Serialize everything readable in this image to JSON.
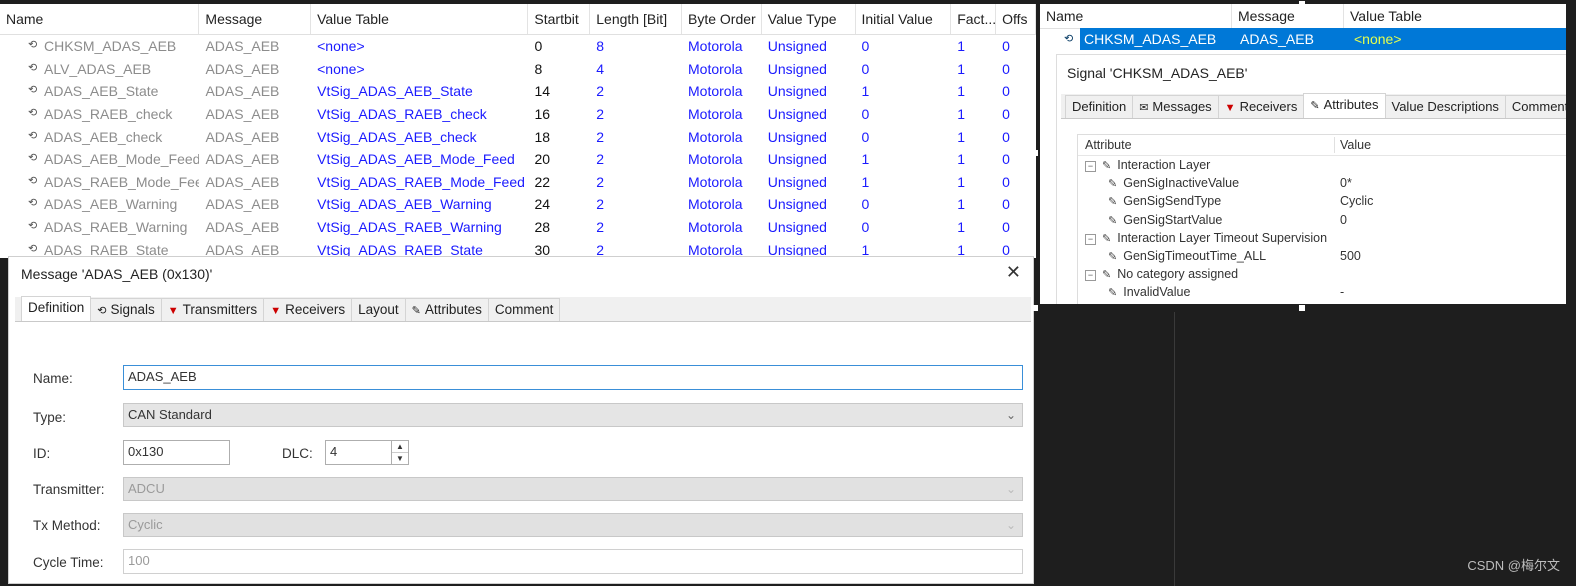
{
  "left_table": {
    "columns": [
      "Name",
      "Message",
      "Value Table",
      "Startbit",
      "Length [Bit]",
      "Byte Order",
      "Value Type",
      "Initial Value",
      "Fact...",
      "Offs"
    ],
    "rows": [
      {
        "name": "CHKSM_ADAS_AEB",
        "message": "ADAS_AEB",
        "value_table": "<none>",
        "startbit": "0",
        "length": "8",
        "byte_order": "Motorola",
        "value_type": "Unsigned",
        "initial": "0",
        "factor": "1",
        "offset": "0"
      },
      {
        "name": "ALV_ADAS_AEB",
        "message": "ADAS_AEB",
        "value_table": "<none>",
        "startbit": "8",
        "length": "4",
        "byte_order": "Motorola",
        "value_type": "Unsigned",
        "initial": "0",
        "factor": "1",
        "offset": "0"
      },
      {
        "name": "ADAS_AEB_State",
        "message": "ADAS_AEB",
        "value_table": "VtSig_ADAS_AEB_State",
        "startbit": "14",
        "length": "2",
        "byte_order": "Motorola",
        "value_type": "Unsigned",
        "initial": "1",
        "factor": "1",
        "offset": "0"
      },
      {
        "name": "ADAS_RAEB_check",
        "message": "ADAS_AEB",
        "value_table": "VtSig_ADAS_RAEB_check",
        "startbit": "16",
        "length": "2",
        "byte_order": "Motorola",
        "value_type": "Unsigned",
        "initial": "0",
        "factor": "1",
        "offset": "0"
      },
      {
        "name": "ADAS_AEB_check",
        "message": "ADAS_AEB",
        "value_table": "VtSig_ADAS_AEB_check",
        "startbit": "18",
        "length": "2",
        "byte_order": "Motorola",
        "value_type": "Unsigned",
        "initial": "0",
        "factor": "1",
        "offset": "0"
      },
      {
        "name": "ADAS_AEB_Mode_Feed",
        "message": "ADAS_AEB",
        "value_table": "VtSig_ADAS_AEB_Mode_Feed",
        "startbit": "20",
        "length": "2",
        "byte_order": "Motorola",
        "value_type": "Unsigned",
        "initial": "1",
        "factor": "1",
        "offset": "0"
      },
      {
        "name": "ADAS_RAEB_Mode_Feed",
        "message": "ADAS_AEB",
        "value_table": "VtSig_ADAS_RAEB_Mode_Feed",
        "startbit": "22",
        "length": "2",
        "byte_order": "Motorola",
        "value_type": "Unsigned",
        "initial": "1",
        "factor": "1",
        "offset": "0"
      },
      {
        "name": "ADAS_AEB_Warning",
        "message": "ADAS_AEB",
        "value_table": "VtSig_ADAS_AEB_Warning",
        "startbit": "24",
        "length": "2",
        "byte_order": "Motorola",
        "value_type": "Unsigned",
        "initial": "0",
        "factor": "1",
        "offset": "0"
      },
      {
        "name": "ADAS_RAEB_Warning",
        "message": "ADAS_AEB",
        "value_table": "VtSig_ADAS_RAEB_Warning",
        "startbit": "28",
        "length": "2",
        "byte_order": "Motorola",
        "value_type": "Unsigned",
        "initial": "0",
        "factor": "1",
        "offset": "0"
      },
      {
        "name": "ADAS_RAEB_State",
        "message": "ADAS_AEB",
        "value_table": "VtSig_ADAS_RAEB_State",
        "startbit": "30",
        "length": "2",
        "byte_order": "Motorola",
        "value_type": "Unsigned",
        "initial": "1",
        "factor": "1",
        "offset": "0"
      }
    ]
  },
  "message_dialog": {
    "title": "Message 'ADAS_AEB (0x130)'",
    "tabs": [
      "Definition",
      "Signals",
      "Transmitters",
      "Receivers",
      "Layout",
      "Attributes",
      "Comment"
    ],
    "labels": {
      "name": "Name:",
      "type": "Type:",
      "id": "ID:",
      "dlc": "DLC:",
      "transmitter": "Transmitter:",
      "tx_method": "Tx Method:",
      "cycle_time": "Cycle Time:"
    },
    "values": {
      "name": "ADAS_AEB",
      "type": "CAN Standard",
      "id": "0x130",
      "dlc": "4",
      "transmitter": "ADCU",
      "tx_method": "Cyclic",
      "cycle_time": "100"
    },
    "close": "✕"
  },
  "right_table": {
    "columns": [
      "Name",
      "Message",
      "Value Table"
    ],
    "selected": {
      "name": "CHKSM_ADAS_AEB",
      "message": "ADAS_AEB",
      "value_table": "<none>"
    }
  },
  "signal_dialog": {
    "title": "Signal 'CHKSM_ADAS_AEB'",
    "tabs": [
      "Definition",
      "Messages",
      "Receivers",
      "Attributes",
      "Value Descriptions",
      "Comment"
    ],
    "attr_header": {
      "attribute": "Attribute",
      "value": "Value"
    },
    "attrs": [
      {
        "label": "Interaction Layer",
        "value": "",
        "level": 0,
        "group": true
      },
      {
        "label": "GenSigInactiveValue",
        "value": "0*",
        "level": 1,
        "group": false
      },
      {
        "label": "GenSigSendType",
        "value": "Cyclic",
        "level": 1,
        "group": false
      },
      {
        "label": "GenSigStartValue",
        "value": "0",
        "level": 1,
        "group": false
      },
      {
        "label": "Interaction Layer Timeout Supervision",
        "value": "",
        "level": 0,
        "group": true
      },
      {
        "label": "GenSigTimeoutTime_ALL",
        "value": "500",
        "level": 1,
        "group": false
      },
      {
        "label": "No category assigned",
        "value": "",
        "level": 0,
        "group": true
      },
      {
        "label": "InvalidValue",
        "value": "-",
        "level": 1,
        "group": false
      }
    ]
  },
  "watermark": "CSDN @梅尔文",
  "colors": {
    "link_blue": "#1a1aff",
    "selection": "#0078d7",
    "selected_text_yellow": "#e6ff4d"
  }
}
